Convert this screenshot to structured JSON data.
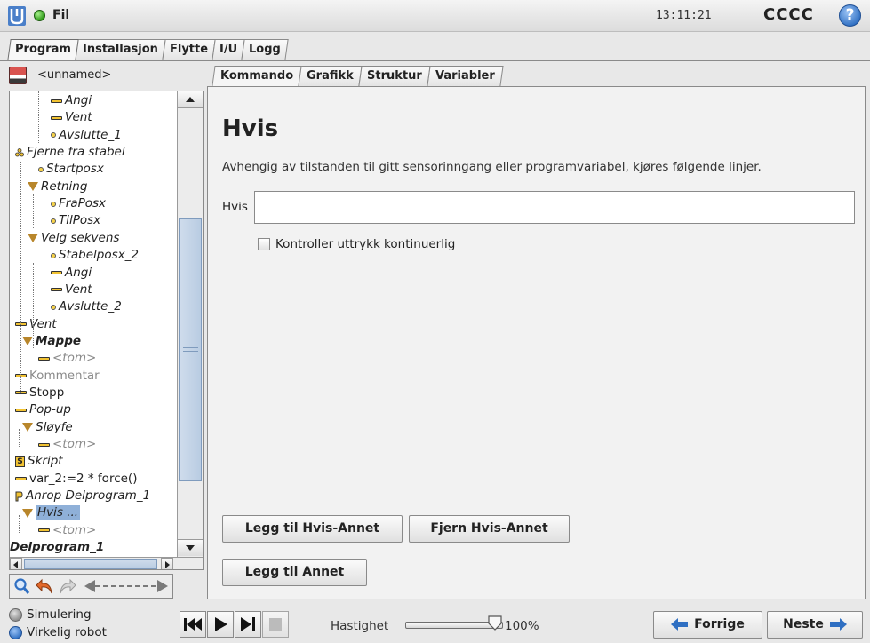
{
  "topbar": {
    "file_menu": "Fil",
    "clock": "13:11:21",
    "robot_name": "CCCC",
    "help_label": "?"
  },
  "main_tabs": [
    {
      "label": "Program",
      "active": true
    },
    {
      "label": "Installasjon",
      "active": false
    },
    {
      "label": "Flytte",
      "active": false
    },
    {
      "label": "I/U",
      "active": false
    },
    {
      "label": "Logg",
      "active": false
    }
  ],
  "program": {
    "name": "<unnamed>"
  },
  "tree": {
    "nodes": [
      {
        "label": "Angi",
        "icon": "bar-icon",
        "style": "italic"
      },
      {
        "label": "Vent",
        "icon": "bar-icon",
        "style": "italic"
      },
      {
        "label": "Avslutte_1",
        "icon": "dot-icon",
        "style": "italic"
      },
      {
        "label": "Fjerne fra stabel",
        "icon": "stack-icon",
        "style": "italic"
      },
      {
        "label": "Startposx",
        "icon": "dot-icon",
        "style": "italic"
      },
      {
        "label": "Retning",
        "icon": "triangle-icon",
        "style": "italic"
      },
      {
        "label": "FraPosx",
        "icon": "dot-icon",
        "style": "italic"
      },
      {
        "label": "TilPosx",
        "icon": "dot-icon",
        "style": "italic"
      },
      {
        "label": "Velg sekvens",
        "icon": "triangle-icon",
        "style": "italic"
      },
      {
        "label": "Stabelposx_2",
        "icon": "dot-icon",
        "style": "italic"
      },
      {
        "label": "Angi",
        "icon": "bar-icon",
        "style": "italic"
      },
      {
        "label": "Vent",
        "icon": "bar-icon",
        "style": "italic"
      },
      {
        "label": "Avslutte_2",
        "icon": "dot-icon",
        "style": "italic"
      },
      {
        "label": "Vent",
        "icon": "bar-icon",
        "style": "italic"
      },
      {
        "label": "Mappe",
        "icon": "triangle-icon",
        "style": "bold-italic"
      },
      {
        "label": "<tom>",
        "icon": "bar-icon",
        "style": "gray-italic"
      },
      {
        "label": "Kommentar",
        "icon": "bar-icon",
        "style": "gray"
      },
      {
        "label": "Stopp",
        "icon": "bar-icon",
        "style": "normal"
      },
      {
        "label": "Pop-up",
        "icon": "bar-icon",
        "style": "italic"
      },
      {
        "label": "Sløyfe",
        "icon": "triangle-icon",
        "style": "italic"
      },
      {
        "label": "<tom>",
        "icon": "bar-icon",
        "style": "gray-italic"
      },
      {
        "label": "Skript",
        "icon": "script-icon",
        "style": "italic"
      },
      {
        "label": "var_2:=2 * force()",
        "icon": "bar-icon",
        "style": "normal"
      },
      {
        "label": "Anrop Delprogram_1",
        "icon": "call-icon",
        "style": "italic"
      },
      {
        "label": "Hvis ...",
        "icon": "triangle-icon",
        "style": "italic-selected"
      },
      {
        "label": "<tom>",
        "icon": "bar-icon",
        "style": "gray-italic"
      },
      {
        "label": "Delprogram_1",
        "icon": "none",
        "style": "bold-italic"
      }
    ]
  },
  "sub_tabs": [
    {
      "label": "Kommando",
      "active": true
    },
    {
      "label": "Grafikk",
      "active": false
    },
    {
      "label": "Struktur",
      "active": false
    },
    {
      "label": "Variabler",
      "active": false
    }
  ],
  "content": {
    "title": "Hvis",
    "description": "Avhengig av tilstanden til gitt sensorinngang eller programvariabel, kjøres følgende linjer.",
    "hvis_label": "Hvis",
    "hvis_value": "",
    "continuous_check_label": "Kontroller uttrykk kontinuerlig",
    "continuous_checked": false,
    "add_else_if_label": "Legg til Hvis-Annet",
    "remove_else_if_label": "Fjern Hvis-Annet",
    "add_else_label": "Legg til Annet"
  },
  "bottom": {
    "mode_simulation": "Simulering",
    "mode_real": "Virkelig robot",
    "speed_label": "Hastighet",
    "speed_value": "100%",
    "speed_fraction": 1.0,
    "prev_label": "Forrige",
    "next_label": "Neste"
  },
  "colors": {
    "accent_blue": "#2f6fc2",
    "selection": "#8fb0d8",
    "status_green": "#2e9a18",
    "node_yellow": "#f1c232"
  }
}
